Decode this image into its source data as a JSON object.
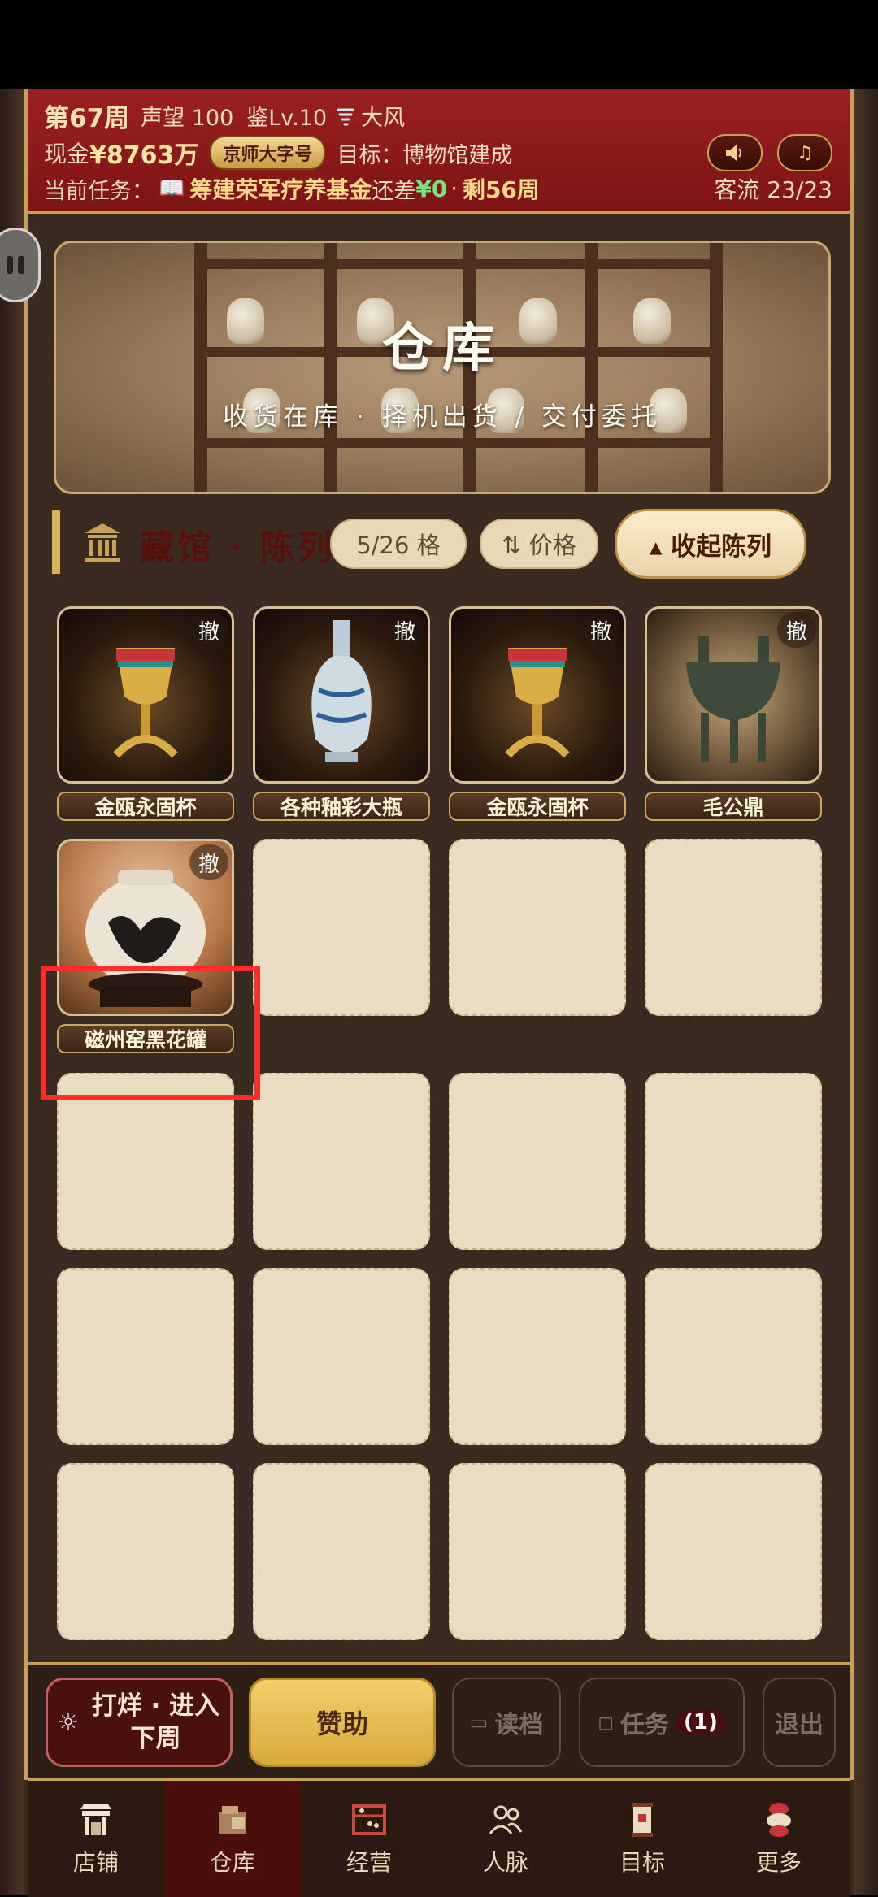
{
  "header": {
    "week": "第67周",
    "reputation": "声望 100",
    "appraisal": "鉴Lv.10",
    "weather": "大风",
    "cash_label": "现金",
    "cash_value": "¥8763万",
    "badge": "京师大字号",
    "goal": "目标：博物馆建成",
    "task_label": "当前任务：",
    "task_name": "筹建荣军疗养基金",
    "task_gap_label": "还差",
    "task_gap_value": "¥0",
    "task_sep": "·",
    "remain": "剩56周",
    "traffic": "客流 23/23",
    "sound_icon": "speaker-icon",
    "music_icon": "music-icon"
  },
  "banner": {
    "title": "仓库",
    "subtitle": "收货在库 · 择机出货 / 交付委托"
  },
  "section": {
    "title": "藏馆 · 陈列",
    "slots": "5/26 格",
    "sort": "⇅ 价格",
    "collapse": "▴ 收起陈列"
  },
  "items": [
    {
      "name": "金瓯永固杯",
      "remove": "撤",
      "color": "#c9a040"
    },
    {
      "name": "各种釉彩大瓶",
      "remove": "撤",
      "color": "#9bb6c6"
    },
    {
      "name": "金瓯永固杯",
      "remove": "撤",
      "color": "#c9a040"
    },
    {
      "name": "毛公鼎",
      "remove": "撤",
      "color": "#3f4a3c"
    },
    {
      "name": "磁州窑黑花罐",
      "remove": "撤",
      "color": "#e9e2d2"
    }
  ],
  "actions": {
    "week": "打烊 · 进入下周",
    "sponsor": "赞助",
    "load": "读档",
    "tasks": "任务",
    "tasks_count": "(1)",
    "exit": "退出"
  },
  "nav": [
    {
      "label": "店铺",
      "icon": "shop-icon"
    },
    {
      "label": "仓库",
      "icon": "warehouse-icon"
    },
    {
      "label": "经营",
      "icon": "abacus-icon"
    },
    {
      "label": "人脉",
      "icon": "people-icon"
    },
    {
      "label": "目标",
      "icon": "scroll-icon"
    },
    {
      "label": "更多",
      "icon": "more-icon"
    }
  ]
}
